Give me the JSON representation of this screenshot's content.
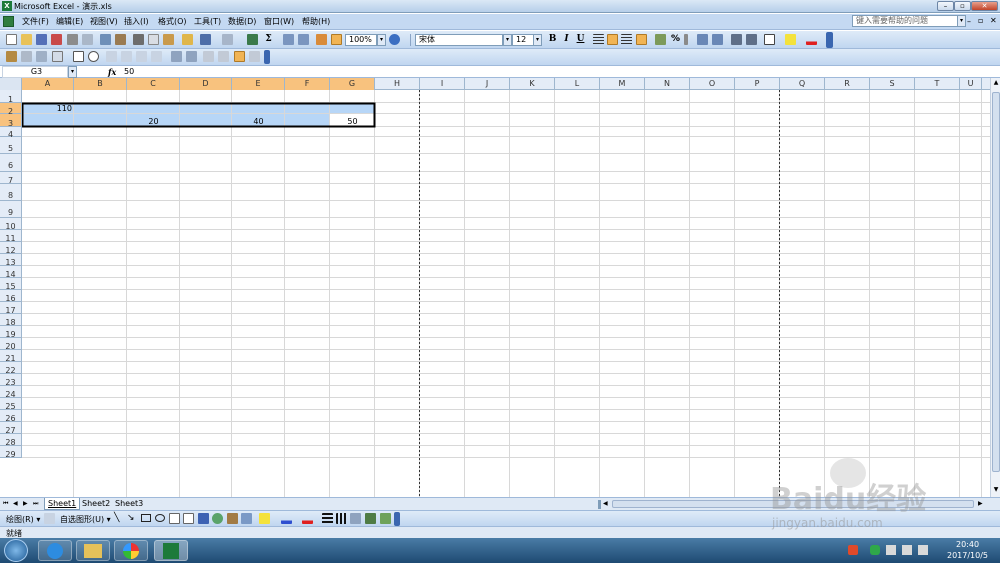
{
  "window": {
    "title": "Microsoft Excel - 演示.xls",
    "help_placeholder": "键入需要帮助的问题"
  },
  "menu": [
    "文件(F)",
    "编辑(E)",
    "视图(V)",
    "插入(I)",
    "格式(O)",
    "工具(T)",
    "数据(D)",
    "窗口(W)",
    "帮助(H)"
  ],
  "toolbar": {
    "zoom": "100%",
    "font_name": "宋体",
    "font_size": "12",
    "bold": "B",
    "italic": "I",
    "underline": "U",
    "percent": "%"
  },
  "formula_bar": {
    "name_box": "G3",
    "fx": "fx",
    "content": "50"
  },
  "columns": [
    "A",
    "B",
    "C",
    "D",
    "E",
    "F",
    "G",
    "H",
    "I",
    "J",
    "K",
    "L",
    "M",
    "N",
    "O",
    "P",
    "Q",
    "R",
    "S",
    "T",
    "U"
  ],
  "rows": [
    "1",
    "2",
    "3",
    "4",
    "5",
    "6",
    "7",
    "8",
    "9",
    "10",
    "11",
    "12",
    "13",
    "14",
    "15",
    "16",
    "17",
    "18",
    "19",
    "20",
    "21",
    "22",
    "23",
    "24",
    "25",
    "26",
    "27",
    "28",
    "29"
  ],
  "cells": {
    "A2": "110",
    "C3": "20",
    "E3": "40",
    "G3": "50"
  },
  "sheets": [
    "Sheet1",
    "Sheet2",
    "Sheet3"
  ],
  "drawing_toolbar": {
    "draw": "绘图(R) ▾",
    "autoshapes": "自选图形(U) ▾"
  },
  "status": {
    "text": "就绪"
  },
  "taskbar": {
    "time": "20:40",
    "date": "2017/10/5"
  },
  "watermark": {
    "text": "Baidu经验",
    "url": "jingyan.baidu.com"
  },
  "colors": {
    "selection": "#b7d6f7",
    "header_selected": "#f8c27e",
    "grid": "#d8d8d8"
  }
}
